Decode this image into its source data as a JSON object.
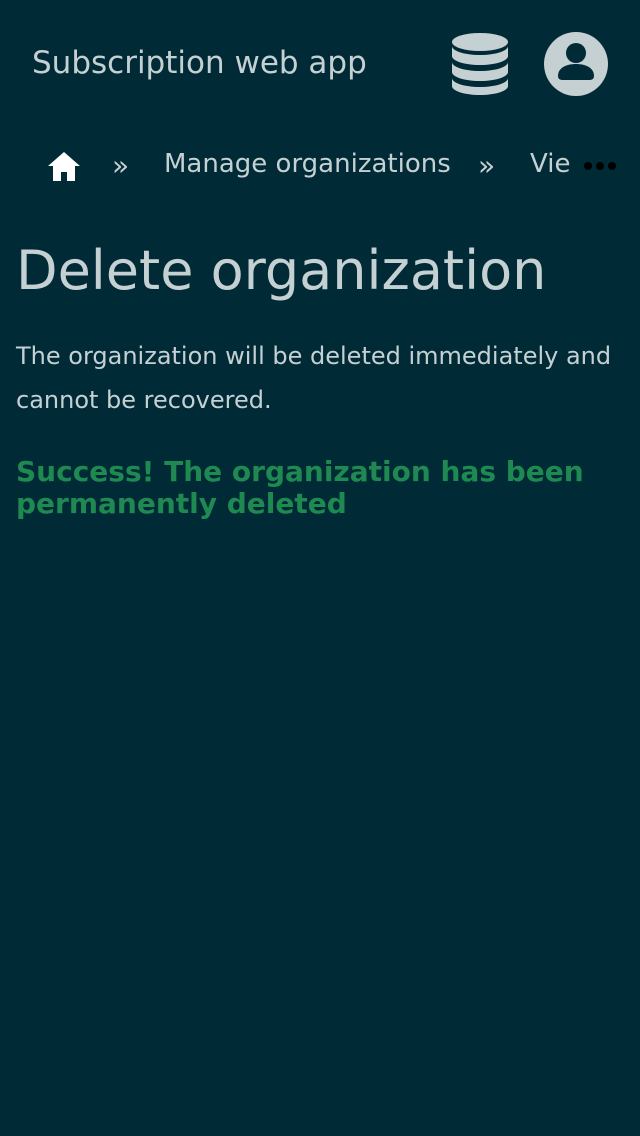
{
  "header": {
    "app_title": "Subscription web app",
    "database_icon": "database-icon",
    "user_icon": "user-circle-icon"
  },
  "breadcrumb": {
    "home_icon": "home-icon",
    "separator": "»",
    "items": [
      {
        "label": "Manage organizations"
      },
      {
        "label": "Vie"
      }
    ],
    "overflow_icon": "ellipsis-icon"
  },
  "main": {
    "title": "Delete organization",
    "description": "The organization will be deleted immediately and cannot be recovered.",
    "success_message": "Success! The organization has been permanently deleted"
  },
  "colors": {
    "background": "#002b36",
    "text": "#c5d0d3",
    "success": "#1e8a52",
    "icon_white": "#ffffff"
  }
}
